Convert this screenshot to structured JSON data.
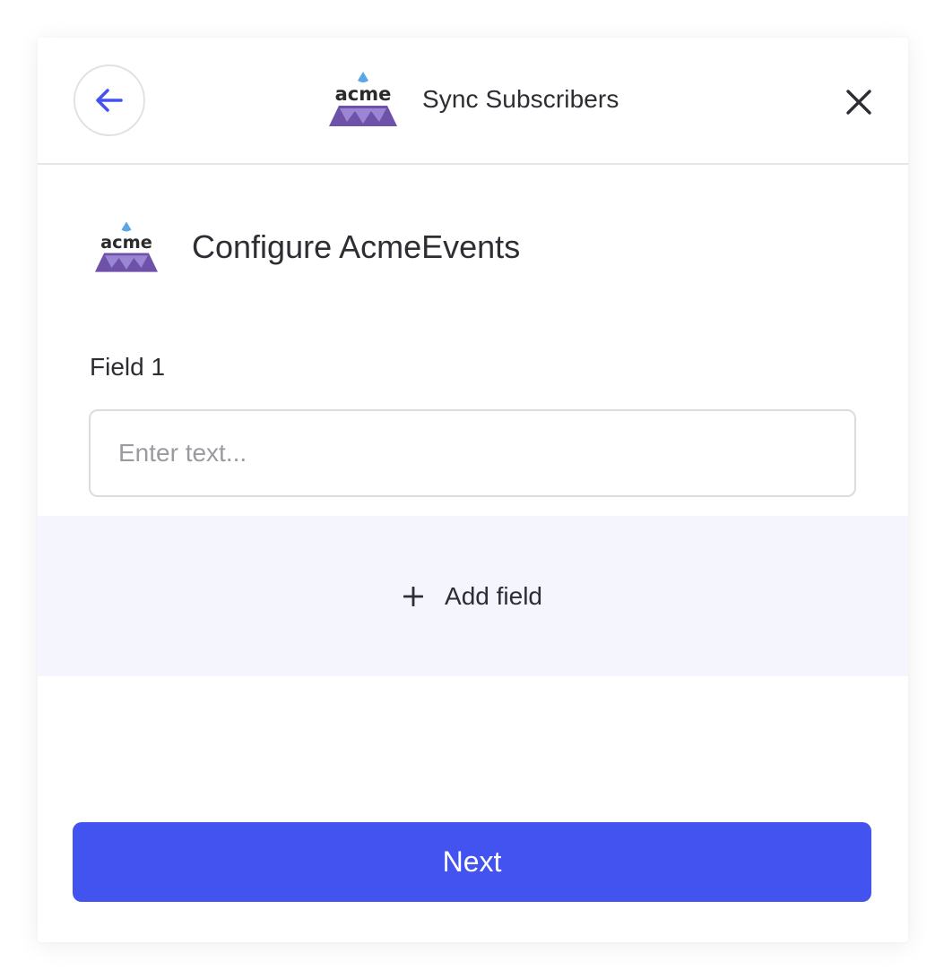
{
  "header": {
    "title": "Sync Subscribers",
    "back_icon": "arrow-left-icon",
    "close_icon": "close-icon",
    "logo_text": "acme"
  },
  "main": {
    "config_title": "Configure AcmeEvents",
    "logo_text": "acme",
    "field": {
      "label": "Field 1",
      "value": "",
      "placeholder": "Enter text..."
    },
    "add_field": {
      "icon": "plus-icon",
      "label": "Add field"
    }
  },
  "footer": {
    "next_label": "Next"
  },
  "colors": {
    "accent": "#4353ef",
    "logo_purple": "#7b5fb8",
    "logo_drop": "#5ba7e6",
    "add_field_bg": "#f4f5fd",
    "text": "#2d2d33"
  }
}
